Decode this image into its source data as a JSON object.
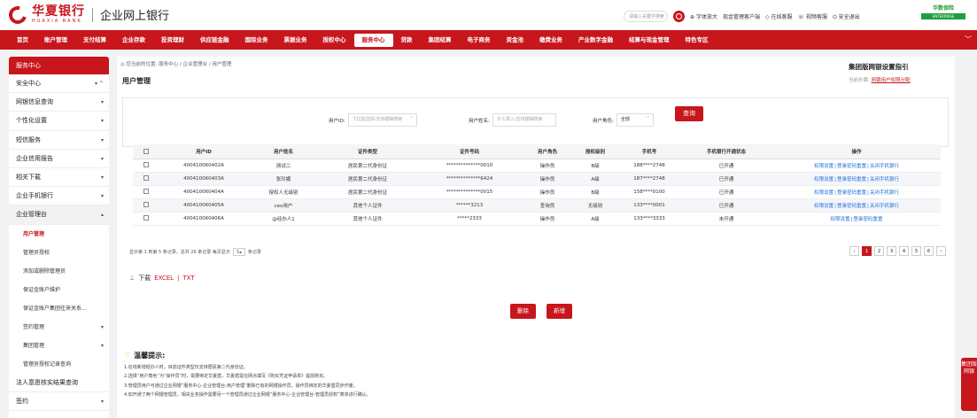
{
  "header": {
    "logo_cn": "华夏银行",
    "logo_en": "HUAXIA BANK",
    "subtitle": "企业网上银行",
    "search_placeholder": "请输入关键字搜索",
    "tools": [
      "字体放大",
      "现金管理客户端",
      "在线客服",
      "视频客服",
      "安全退出"
    ],
    "badge_top": "华数保险",
    "badge_bottom": "ENTERPRISE"
  },
  "nav": {
    "items": [
      "首页",
      "账户管理",
      "支付结算",
      "企业存款",
      "投资理财",
      "供应链金融",
      "国际业务",
      "票据业务",
      "授权中心",
      "服务中心",
      "贷款",
      "集团结算",
      "电子商务",
      "资金池",
      "缴费业务",
      "产业数字金融",
      "结算与现金管理",
      "特色专区"
    ],
    "active_index": 9
  },
  "sidebar": {
    "head": "服务中心",
    "items": [
      "安全中心",
      "网银信息查询",
      "个性化设置",
      "短信服务",
      "企业信用报告",
      "相关下载",
      "企业手机银行",
      "企业管理台"
    ],
    "sub_items": [
      "用户管理",
      "管理员授权",
      "添加或删除管理员",
      "保证金账户维护",
      "保证金账户集团往来关系..."
    ],
    "sub_items2": [
      "签约管理",
      "集团管理",
      "管理员授权记录查询"
    ],
    "bottom_items": [
      "法人意愿核实结果查询",
      "签约"
    ]
  },
  "main": {
    "breadcrumb": "◎ 您当前的位置: 服务中心 / 企业管理台 / 用户管理",
    "title": "用户管理",
    "guide_title": "集团版网银设置指引",
    "guide_step_label": "当前步骤:",
    "guide_step_link": "网银用户权限分配",
    "filters": {
      "user_id_label": "用户ID:",
      "user_id_placeholder": "下拉能选择/支持模糊搜索",
      "user_name_label": "用户姓名:",
      "user_name_placeholder": "手工录入/支持模糊搜索",
      "role_label": "用户角色:",
      "role_value": "全部"
    },
    "query_label": "查询",
    "columns": [
      "",
      "用户ID",
      "用户姓名",
      "证件类型",
      "证件号码",
      "用户角色",
      "授权级别",
      "手机号",
      "手机银行开通状态",
      "操作"
    ],
    "rows": [
      {
        "id": "400410060402A",
        "name": "测试二",
        "cert_type": "居民第二代身份证",
        "cert_no": "**************0010",
        "role": "操作员",
        "level": "B级",
        "phone": "188****2748",
        "status": "已开通",
        "ops": [
          "权限设置",
          "登录密码重置",
          "关闭手机银行"
        ]
      },
      {
        "id": "400410060403A",
        "name": "张玲娥",
        "cert_type": "居民第二代身份证",
        "cert_no": "**************6424",
        "role": "操作员",
        "level": "A级",
        "phone": "187****2748",
        "status": "已开通",
        "ops": [
          "权限设置",
          "登录密码重置",
          "关闭手机银行"
        ]
      },
      {
        "id": "400410060404A",
        "name": "授权人无级别",
        "cert_type": "居民第二代身份证",
        "cert_no": "**************0015",
        "role": "操作员",
        "level": "B级",
        "phone": "158****0100",
        "status": "已开通",
        "ops": [
          "权限设置",
          "登录密码重置",
          "关闭手机银行"
        ]
      },
      {
        "id": "400410060405A",
        "name": "ceo用户",
        "cert_type": "其他个人证件",
        "cert_no": "******3213",
        "role": "查询员",
        "level": "无级别",
        "phone": "133****0001",
        "status": "已开通",
        "ops": [
          "权限设置",
          "登录密码重置",
          "关闭手机银行"
        ]
      },
      {
        "id": "400410060406A",
        "name": "@经办人1",
        "cert_type": "其他个人证件",
        "cert_no": "*****2333",
        "role": "操作员",
        "level": "A级",
        "phone": "133****3333",
        "status": "未开通",
        "ops": [
          "权限设置",
          "登录密码重置"
        ]
      }
    ],
    "pager_text_1": "显示第 1 到第 5 条记录，总共 26 条记录 每页显示",
    "pager_size": "5",
    "pager_text_2": "条记录",
    "pages": [
      "‹",
      "1",
      "2",
      "3",
      "4",
      "5",
      "6",
      "›"
    ],
    "active_page": "1",
    "download_label": "下载",
    "download_excel": "EXCEL",
    "download_sep": "|",
    "download_txt": "TXT",
    "delete_label": "删除",
    "add_label": "新增",
    "tips_title": "温馨提示:",
    "tips": [
      "1.在线新增经办人时，目前证件类型仅支持居民第二代身份证。",
      "2.选择“用户角色”为“操作员”时，需要绑定华夏盾，华夏盾需在网点填写《购买凭证申请单》提前购买。",
      "3.管理员用户可通过企业网银“服务中心-企业管理台-用户管理”删除已有的网银操作员，操作员绑定的华夏盾同步作废。",
      "4.如开通了两个网银管理员，相关业务操作需要另一个管理员通过企业网银“服务中心-企业管理台-管理员授权”菜单进行确认。"
    ],
    "float_tab": "集团版网银"
  }
}
